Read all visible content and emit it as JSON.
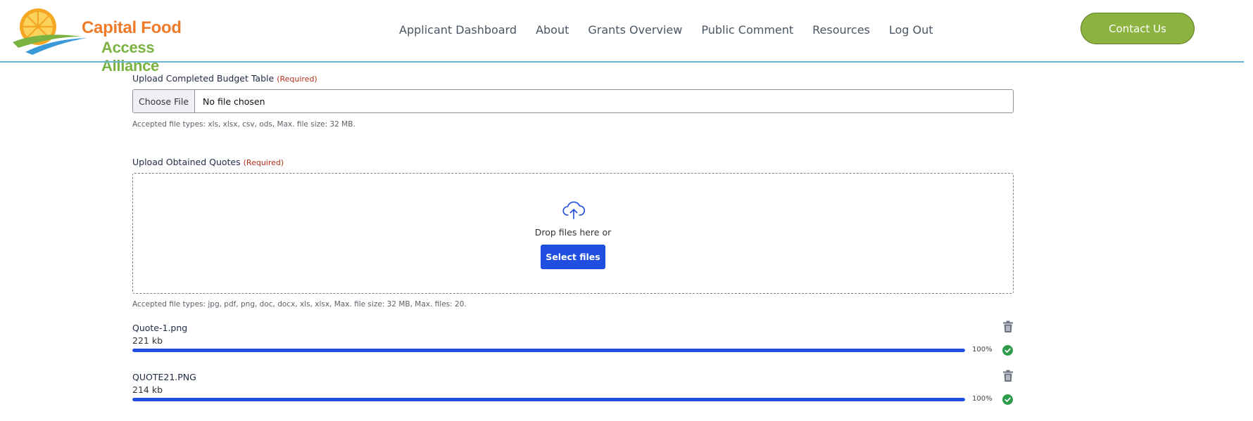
{
  "header": {
    "logo": {
      "line1": "Capital Food",
      "line2": "Access Alliance"
    },
    "nav": [
      {
        "label": "Applicant Dashboard"
      },
      {
        "label": "About"
      },
      {
        "label": "Grants Overview"
      },
      {
        "label": "Public Comment"
      },
      {
        "label": "Resources"
      },
      {
        "label": "Log Out"
      }
    ],
    "contact_label": "Contact Us",
    "colors": {
      "logo_orange": "#ee7a2a",
      "logo_green": "#7bb342",
      "contact_bg": "#8cb23f",
      "divider": "#6ab4d8"
    }
  },
  "budget_upload": {
    "label": "Upload Completed Budget Table",
    "required": "(Required)",
    "choose_label": "Choose File",
    "status": "No file chosen",
    "help": "Accepted file types: xls, xlsx, csv, ods, Max. file size: 32 MB."
  },
  "quotes_upload": {
    "label": "Upload Obtained Quotes",
    "required": "(Required)",
    "drop_text": "Drop files here or",
    "select_label": "Select files",
    "upload_icon": "cloud-upload-icon",
    "help": "Accepted file types: jpg, pdf, png, doc, docx, xls, xlsx, Max. file size: 32 MB, Max. files: 20.",
    "files": [
      {
        "name": "Quote-1.png",
        "size": "221 kb",
        "progress": 100,
        "percent_label": "100%"
      },
      {
        "name": "QUOTE21.PNG",
        "size": "214 kb",
        "progress": 100,
        "percent_label": "100%"
      }
    ],
    "accent": "#1f4ee0",
    "success": "#2e9b4a"
  }
}
